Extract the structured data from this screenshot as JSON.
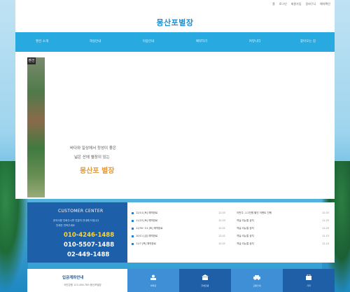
{
  "top_links": [
    "홈",
    "로그인",
    "회원가입",
    "장바구니",
    "예약확인"
  ],
  "logo": "몽산포별장",
  "nav": [
    "펜션 소개",
    "객실안내",
    "이용안내",
    "예약하기",
    "커뮤니티",
    "찾아오는 길"
  ],
  "slider": {
    "badge": "펜션",
    "line1": "바다와 일상에서 정성이 좋은",
    "line2": "넓은 산에 별장이 있는",
    "brand": "몽산포 별장"
  },
  "customer": {
    "title": "CUSTOMER CENTER",
    "desc1": "문의사항 전화주시면 친절히 안내해 드립니다",
    "desc2": "언제든 연락주세요",
    "phone1": "010-4246-1488",
    "phone2": "010-5507-1488",
    "phone3": "02-449-1488"
  },
  "board1": [
    {
      "title": "12/14 [토] 예약완료",
      "date": "12.03"
    },
    {
      "title": "11/23 [토] 예약완료",
      "date": "12.03"
    },
    {
      "title": "11/30~21 [토] 예약완료",
      "date": "12.01"
    },
    {
      "title": "10/11 [금] 예약완료",
      "date": "12.01"
    },
    {
      "title": "11/7 [목] 예약완료",
      "date": "12.01"
    }
  ],
  "board2": [
    {
      "title": "이번주 -1.2천원 할인 이벤트 진행",
      "date": "12.03"
    },
    {
      "title": "객실 리뉴얼 공지",
      "date": "11.25"
    },
    {
      "title": "객실 리뉴얼 공지",
      "date": "11.20"
    },
    {
      "title": "객실 리뉴얼 공지",
      "date": "11.15"
    },
    {
      "title": "객실 리뉴얼 공지",
      "date": "11.10"
    }
  ],
  "reserve": {
    "title": "입금계좌안내",
    "desc": "국민은행 123-456-789 몽산포별장"
  },
  "quick": [
    "바베큐",
    "주변관광",
    "교통안내",
    "기타"
  ],
  "colors": {
    "nav": "#28a9e0",
    "customer_bg": "#1d5fa8",
    "phone_highlight": "#ffd43b",
    "logo": "#1f8fd0"
  }
}
